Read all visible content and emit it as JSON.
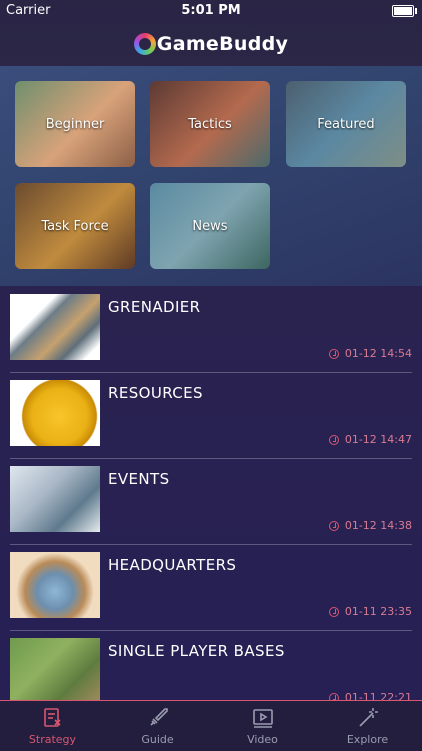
{
  "status_bar": {
    "carrier": "Carrier",
    "time": "5:01 PM"
  },
  "header": {
    "app_name": "GameBuddy"
  },
  "categories": [
    {
      "label": "Beginner"
    },
    {
      "label": "Tactics"
    },
    {
      "label": "Featured"
    },
    {
      "label": "Task Force"
    },
    {
      "label": "News"
    }
  ],
  "articles": [
    {
      "title": "GRENADIER",
      "date": "01-12 14:54"
    },
    {
      "title": "RESOURCES",
      "date": "01-12 14:47"
    },
    {
      "title": "EVENTS",
      "date": "01-12 14:38"
    },
    {
      "title": "HEADQUARTERS",
      "date": "01-11 23:35"
    },
    {
      "title": "SINGLE PLAYER BASES",
      "date": "01-11 22:21"
    }
  ],
  "tabs": [
    {
      "label": "Strategy",
      "icon": "strategy-icon",
      "active": true
    },
    {
      "label": "Guide",
      "icon": "sword-icon",
      "active": false
    },
    {
      "label": "Video",
      "icon": "video-icon",
      "active": false
    },
    {
      "label": "Explore",
      "icon": "magic-wand-icon",
      "active": false
    }
  ],
  "colors": {
    "accent": "#d8566f",
    "background": "#2a2350",
    "tab_inactive": "#9a9cb0"
  }
}
